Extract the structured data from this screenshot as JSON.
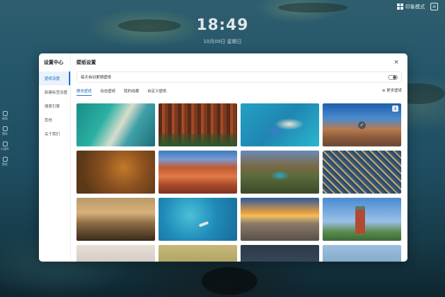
{
  "topbar": {
    "mode_label": "印象模式",
    "home_glyph": "⌂"
  },
  "clock": {
    "time": "18:49",
    "date": "10月09日 星期日"
  },
  "dock": {
    "items": [
      "桌面",
      "图标",
      "小组件",
      "壁纸"
    ]
  },
  "sidebar": {
    "title": "设置中心",
    "items": [
      {
        "label": "壁纸设置",
        "active": true
      },
      {
        "label": "新建标签设置",
        "active": false
      },
      {
        "label": "搜索引擎",
        "active": false
      },
      {
        "label": "其他",
        "active": false
      },
      {
        "label": "关于我们",
        "active": false
      }
    ]
  },
  "panel": {
    "title": "壁纸设置",
    "close_glyph": "×",
    "toggle_label": "每天自动更换壁纸",
    "toggle_on": false
  },
  "tabs": [
    {
      "label": "静态壁纸",
      "active": true
    },
    {
      "label": "动态壁纸",
      "active": false
    },
    {
      "label": "我的收藏",
      "active": false
    },
    {
      "label": "自定义壁纸",
      "active": false
    }
  ],
  "more_label": "⊕ 更多壁纸",
  "wallpapers": [
    {
      "name": "aerial-beach-waves"
    },
    {
      "name": "redwood-forest"
    },
    {
      "name": "tropical-island-aerial"
    },
    {
      "name": "florence-cathedral",
      "selected": true,
      "download": "↓"
    },
    {
      "name": "anemone-fish"
    },
    {
      "name": "red-rock-canyon"
    },
    {
      "name": "crater-lake-aerial"
    },
    {
      "name": "city-aerial-night"
    },
    {
      "name": "misty-hills"
    },
    {
      "name": "boat-turquoise-sea"
    },
    {
      "name": "mountain-sunset"
    },
    {
      "name": "red-water-tower"
    },
    {
      "name": "bright-clouds"
    },
    {
      "name": "golden-field"
    },
    {
      "name": "dark-landscape"
    },
    {
      "name": "blue-sky-city"
    }
  ]
}
